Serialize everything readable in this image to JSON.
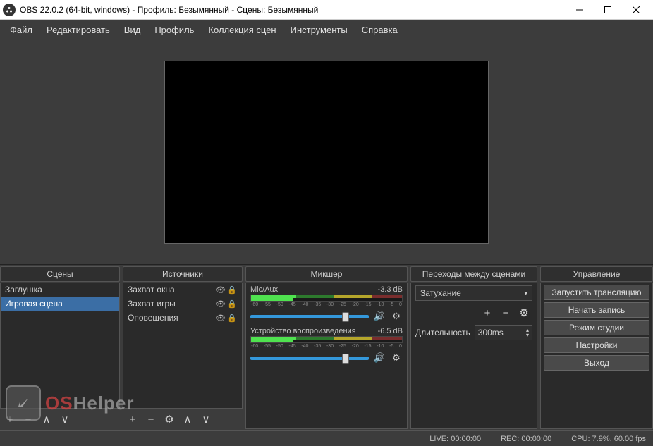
{
  "titlebar": {
    "title": "OBS 22.0.2 (64-bit, windows) - Профиль: Безымянный - Сцены: Безымянный"
  },
  "menu": {
    "file": "Файл",
    "edit": "Редактировать",
    "view": "Вид",
    "profile": "Профиль",
    "scene_collection": "Коллекция сцен",
    "tools": "Инструменты",
    "help": "Справка"
  },
  "panels": {
    "scenes": {
      "title": "Сцены",
      "items": [
        "Заглушка",
        "Игровая сцена"
      ],
      "selected": 1
    },
    "sources": {
      "title": "Источники",
      "items": [
        {
          "name": "Захват окна"
        },
        {
          "name": "Захват игры"
        },
        {
          "name": "Оповещения"
        }
      ]
    },
    "mixer": {
      "title": "Микшер",
      "channels": [
        {
          "name": "Mic/Aux",
          "db": "-3.3 dB"
        },
        {
          "name": "Устройство воспроизведения",
          "db": "-6.5 dB"
        }
      ],
      "ticks": [
        "-60",
        "-55",
        "-50",
        "-45",
        "-40",
        "-35",
        "-30",
        "-25",
        "-20",
        "-15",
        "-10",
        "-5",
        "0"
      ]
    },
    "transitions": {
      "title": "Переходы между сценами",
      "selected": "Затухание",
      "duration_label": "Длительность",
      "duration_value": "300ms"
    },
    "controls": {
      "title": "Управление",
      "buttons": {
        "stream": "Запустить трансляцию",
        "record": "Начать запись",
        "studio": "Режим студии",
        "settings": "Настройки",
        "exit": "Выход"
      }
    }
  },
  "status": {
    "live": "LIVE: 00:00:00",
    "rec": "REC: 00:00:00",
    "cpu": "CPU: 7.9%, 60.00 fps"
  },
  "watermark": {
    "os": "OS",
    "helper": "Helper"
  }
}
